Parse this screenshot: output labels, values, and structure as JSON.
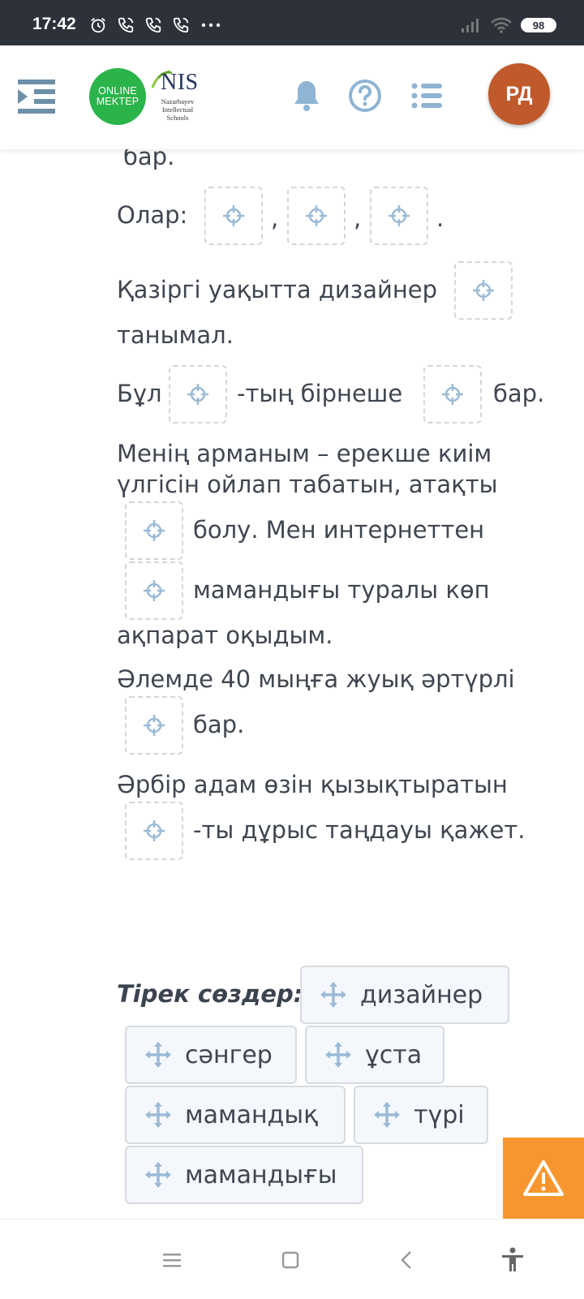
{
  "status_bar": {
    "time": "17:42",
    "left_icons": [
      "alarm-icon",
      "phone-call-icon",
      "phone-call-icon",
      "phone-call-icon",
      "more-dots-icon"
    ],
    "right_icons": [
      "signal-icon",
      "wifi-icon"
    ],
    "battery": "98"
  },
  "header": {
    "menu_icon": "menu-collapse-icon",
    "online_logo_line1": "ONLINE",
    "online_logo_line2": "MEKTEP",
    "nis_title": "NIS",
    "nis_subtitle_line1": "Nazarbayev",
    "nis_subtitle_line2": "Intellectual",
    "nis_subtitle_line3": "Schools",
    "icons": [
      "bell-icon",
      "help-icon",
      "list-icon"
    ],
    "avatar_initials": "РД"
  },
  "exercise": {
    "line_partial": "бар.",
    "olar": "Олар:",
    "comma": ",",
    "period": ".",
    "s2_part1": "Қазіргі уақытта дизайнер",
    "s2_part2": "танымал.",
    "s3_part1": "Бұл",
    "s3_part2": "-тың бірнеше",
    "s3_part3": "бар.",
    "s4_line1": "Менің арманым – ерекше киім",
    "s4_line2": "үлгісін ойлап табатын, атақты",
    "s4_part3": "болу. Мен интернеттен",
    "s4_part4": "мамандығы туралы көп",
    "s4_line5": "ақпарат оқыдым.",
    "s5_line1": "Әлемде 40 мыңға жуық әртүрлі",
    "s5_part2": "бар.",
    "s6_line1": "Әрбір адам өзін қызықтыратын",
    "s6_part2": "-ты дұрыс таңдауы қажет.",
    "drop_icon": "move-target-icon"
  },
  "word_bank": {
    "label": "Тірек сөздер:",
    "chip_icon": "drag-move-icon",
    "words": [
      "дизайнер",
      "сәнгер",
      "ұста",
      "мамандық",
      "түрі",
      "мамандығы"
    ]
  },
  "warning_button_icon": "warning-icon",
  "nav_bar": {
    "icons": [
      "recent-apps-icon",
      "home-icon",
      "back-icon",
      "accessibility-icon"
    ]
  },
  "colors": {
    "status_bar": "#2d323a",
    "online_green": "#2ab44a",
    "avatar": "#c05a2c",
    "icon_blue": "#8fb4d4",
    "warning_orange": "#f7962e",
    "text": "#3f4650"
  }
}
